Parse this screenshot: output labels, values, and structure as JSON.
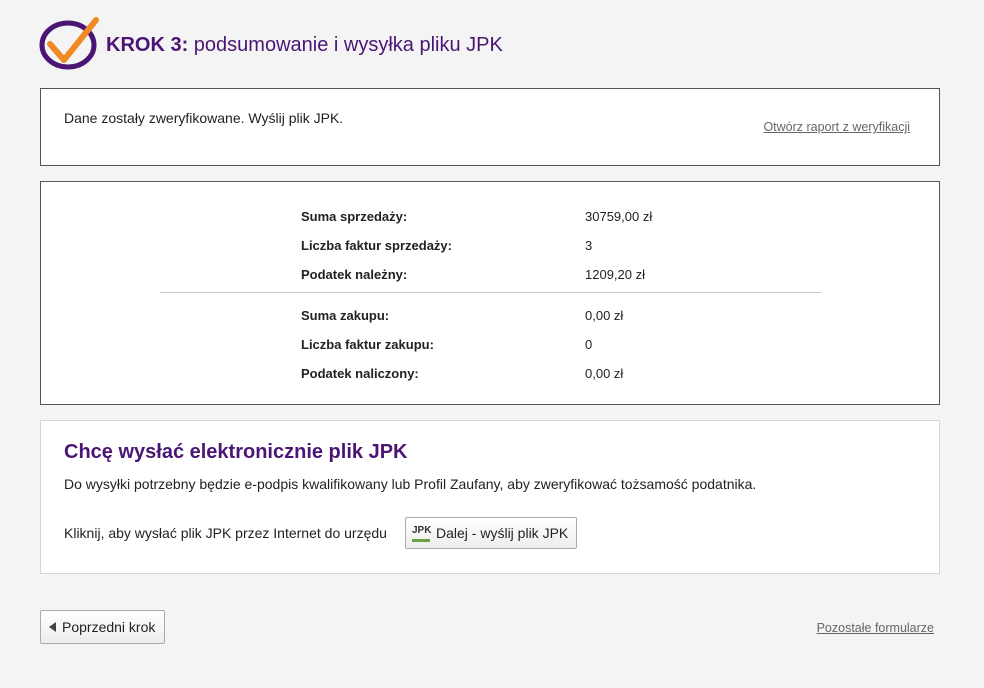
{
  "header": {
    "step_label": "KROK 3:",
    "title": "podsumowanie i wysyłka pliku JPK",
    "logo_icon": "checkmark-circle-icon"
  },
  "verification": {
    "message": "Dane zostały zweryfikowane. Wyślij plik JPK.",
    "report_link": "Otwórz raport z weryfikacji"
  },
  "summary": {
    "sales": [
      {
        "label": "Suma sprzedaży:",
        "value": "30759,00 zł"
      },
      {
        "label": "Liczba faktur sprzedaży:",
        "value": "3"
      },
      {
        "label": "Podatek należny:",
        "value": "1209,20 zł"
      }
    ],
    "purchases": [
      {
        "label": "Suma zakupu:",
        "value": "0,00 zł"
      },
      {
        "label": "Liczba faktur zakupu:",
        "value": "0"
      },
      {
        "label": "Podatek naliczony:",
        "value": "0,00 zł"
      }
    ]
  },
  "send": {
    "title": "Chcę wysłać elektronicznie plik JPK",
    "description": "Do wysyłki potrzebny będzie e-podpis kwalifikowany lub Profil Zaufany, aby zweryfikować tożsamość podatnika.",
    "prompt": "Kliknij, aby wysłać plik JPK przez Internet do urzędu",
    "button_label": "Dalej - wyślij plik JPK",
    "button_icon_text": "JPK"
  },
  "footer": {
    "prev_label": "Poprzedni krok",
    "other_forms_link": "Pozostałe formularze"
  },
  "colors": {
    "brand_purple": "#4b1673",
    "accent_orange": "#f08a24",
    "jpk_green": "#6aa33f"
  }
}
